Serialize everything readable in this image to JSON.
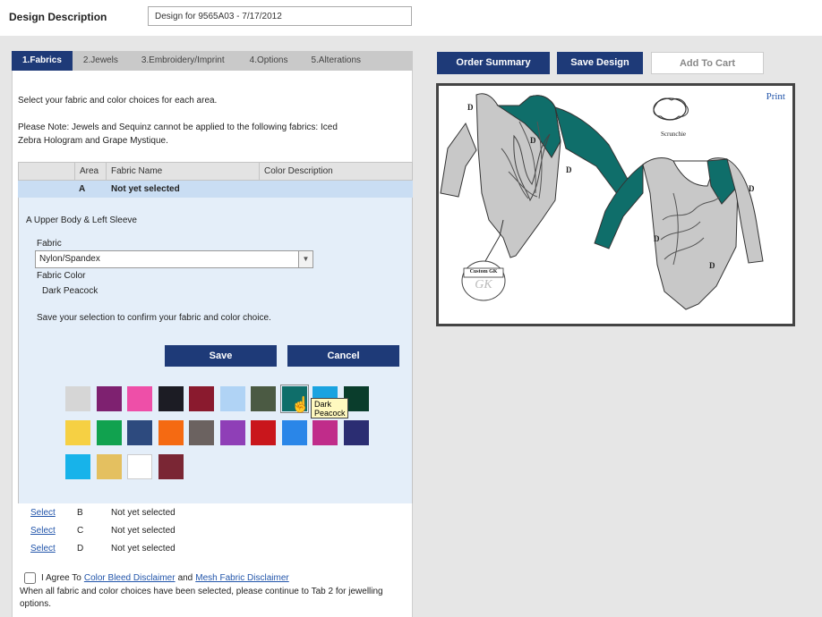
{
  "design": {
    "label": "Design Description",
    "value": "Design for 9565A03 - 7/17/2012"
  },
  "tabs": [
    {
      "label": "1.Fabrics",
      "active": true
    },
    {
      "label": "2.Jewels",
      "active": false
    },
    {
      "label": "3.Embroidery/Imprint",
      "active": false
    },
    {
      "label": "4.Options",
      "active": false
    },
    {
      "label": "5.Alterations",
      "active": false
    }
  ],
  "instructions": {
    "line1": "Select your fabric and color choices for each area.",
    "note1": "Please Note: Jewels and Sequinz cannot be applied to the following fabrics: Iced",
    "note2": "Zebra Hologram and Grape Mystique."
  },
  "table": {
    "headers": [
      "Area",
      "Fabric Name",
      "Color Description"
    ],
    "row_a": {
      "area": "A",
      "fabric": "Not yet selected"
    },
    "detail": {
      "title": "A Upper Body & Left Sleeve",
      "fabric_label": "Fabric",
      "fabric_value": "Nylon/Spandex",
      "color_label": "Fabric Color",
      "color_value": "Dark Peacock",
      "save_note": "Save your selection to confirm your fabric and color choice.",
      "save_label": "Save",
      "cancel_label": "Cancel"
    },
    "other_rows": [
      {
        "link": "Select",
        "area": "B",
        "status": "Not yet selected"
      },
      {
        "link": "Select",
        "area": "C",
        "status": "Not yet selected"
      },
      {
        "link": "Select",
        "area": "D",
        "status": "Not yet selected"
      }
    ]
  },
  "swatches": {
    "row1": [
      "#d6d6d6",
      "#7e2170",
      "#ee4fa8",
      "#1c1c24",
      "#8a1a2e",
      "#b0d3f5",
      "#4b5a43",
      "#0f6e6a",
      "#1aa3e0",
      "#0a3d2c"
    ],
    "row2": [
      "#f6d043",
      "#11a24f",
      "#2d4a7e",
      "#f56a12",
      "#6b6260",
      "#8f3fb7",
      "#c9161c",
      "#2a86e8",
      "#c02c8a",
      "#2b2d72"
    ],
    "row3": [
      "#17b3ea",
      "#e4c060",
      "#ffffff",
      "#7a2634"
    ],
    "selected_index": 7,
    "tooltip": "Dark Peacock"
  },
  "agree": {
    "prefix": "I Agree To",
    "link1": "Color Bleed Disclaimer",
    "and": "and",
    "link2": "Mesh Fabric Disclaimer"
  },
  "final_note": "When all fabric and color choices have been selected, please continue to Tab 2 for jewelling options.",
  "right": {
    "order_summary": "Order Summary",
    "save_design": "Save Design",
    "add_to_cart": "Add To Cart",
    "print": "Print",
    "scrunchie_label": "Scrunchie",
    "logo_text": "Custom GK",
    "logo_mark": "GK",
    "area_label": "D"
  },
  "colors": {
    "navy": "#1e3a78",
    "peacock": "#0f6e6a",
    "body_grey": "#c8c8c8"
  }
}
